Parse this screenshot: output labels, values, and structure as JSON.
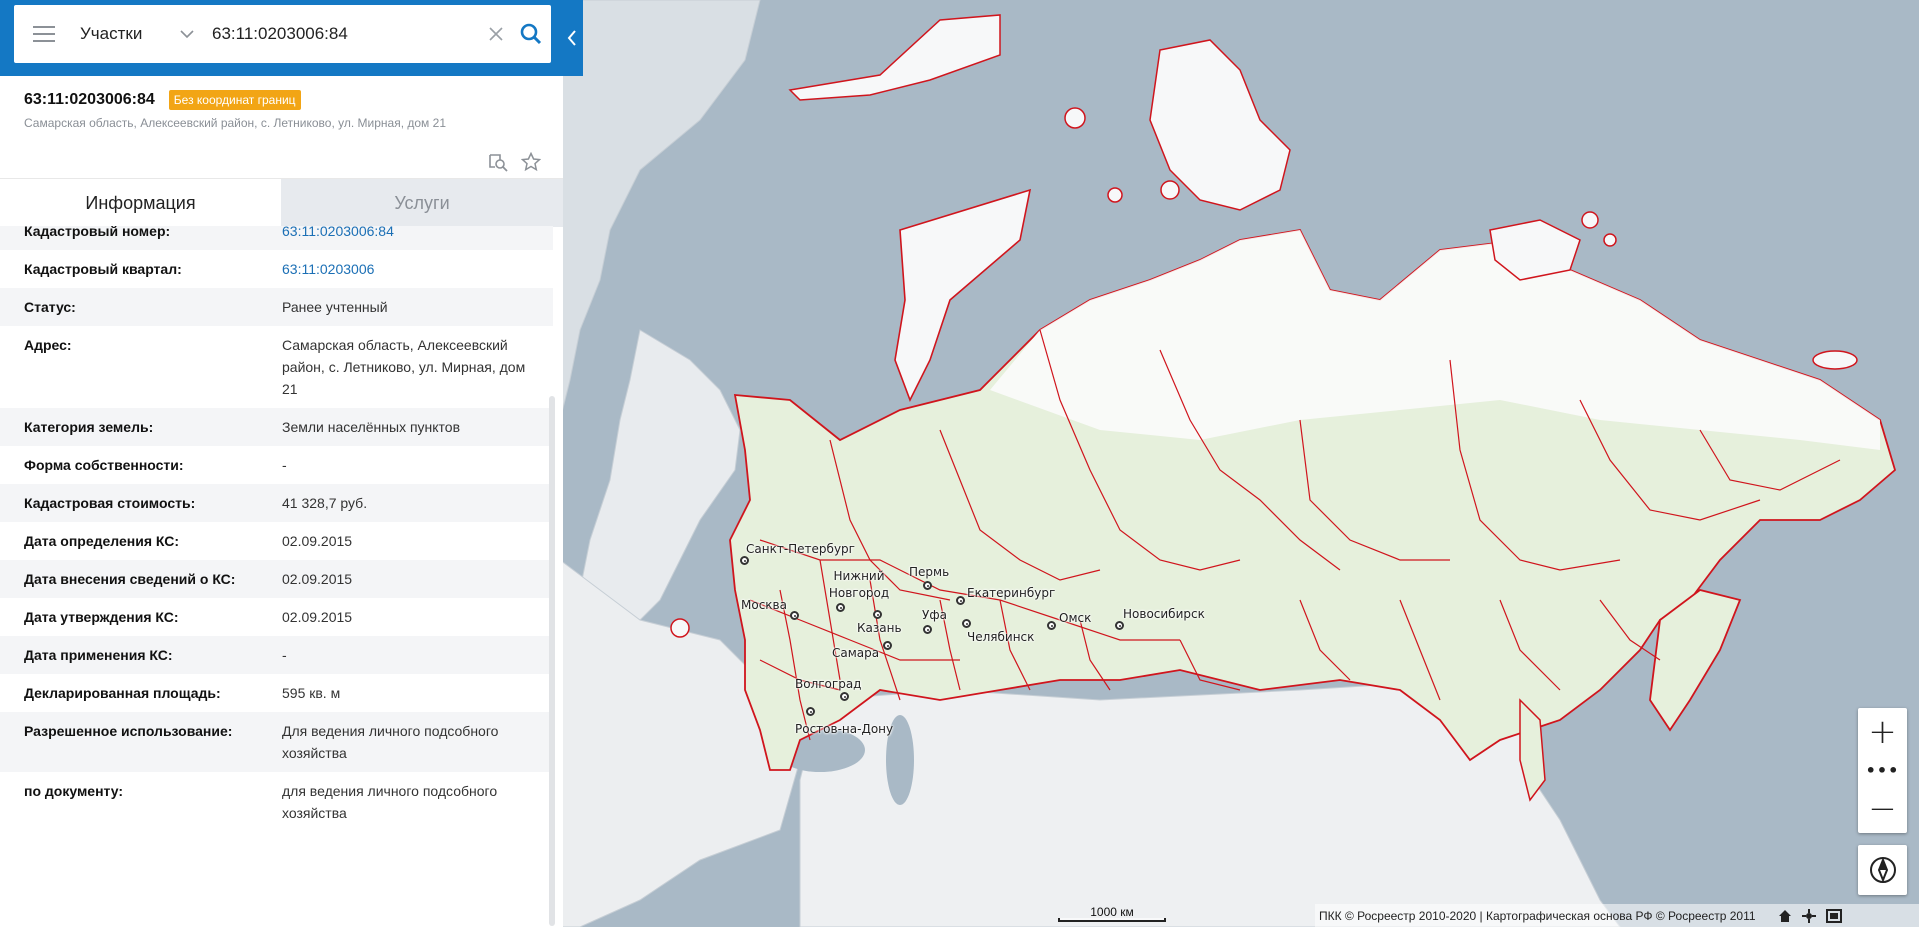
{
  "search": {
    "type_label": "Участки",
    "query": "63:11:0203006:84"
  },
  "object": {
    "cad_number": "63:11:0203006:84",
    "badge": "Без координат границ",
    "address": "Самарская область, Алексеевский район, с. Летниково, ул. Мирная, дом 21"
  },
  "tabs": [
    {
      "label": "Информация"
    },
    {
      "label": "Услуги"
    }
  ],
  "info": [
    {
      "key": "Кадастровый номер:",
      "value": "63:11:0203006:84"
    },
    {
      "key": "Кадастровый квартал:",
      "value": "63:11:0203006"
    },
    {
      "key": "Статус:",
      "value": "Ранее учтенный"
    },
    {
      "key": "Адрес:",
      "value": "Самарская область, Алексеевский район, с. Летниково, ул. Мирная, дом 21"
    },
    {
      "key": "Категория земель:",
      "value": "Земли населённых пунктов"
    },
    {
      "key": "Форма собственности:",
      "value": "-"
    },
    {
      "key": "Кадастровая стоимость:",
      "value": "41 328,7 руб."
    },
    {
      "key": "Дата определения КС:",
      "value": "02.09.2015"
    },
    {
      "key": "Дата внесения сведений о КС:",
      "value": "02.09.2015"
    },
    {
      "key": "Дата утверждения КС:",
      "value": "02.09.2015"
    },
    {
      "key": "Дата применения КС:",
      "value": "-"
    },
    {
      "key": "Декларированная площадь:",
      "value": "595 кв. м"
    },
    {
      "key": "Разрешенное использование:",
      "value": "Для ведения личного подсобного хозяйства"
    },
    {
      "key": "по документу:",
      "value": "для ведения личного подсобного хозяйства"
    }
  ],
  "map": {
    "cities": [
      {
        "name": "Санкт-Петербург"
      },
      {
        "name": "Нижний Новгород"
      },
      {
        "name": "Москва"
      },
      {
        "name": "Пермь"
      },
      {
        "name": "Екатеринбург"
      },
      {
        "name": "Уфа"
      },
      {
        "name": "Казань"
      },
      {
        "name": "Челябинск"
      },
      {
        "name": "Омск"
      },
      {
        "name": "Новосибирск"
      },
      {
        "name": "Самара"
      },
      {
        "name": "Волгоград"
      },
      {
        "name": "Ростов-на-Дону"
      }
    ],
    "scale_label": "1000 км",
    "attribution": "ПКК © Росреестр 2010-2020 | Картографическая основа РФ © Росреестр 2011",
    "zoom_in": "+",
    "zoom_more": "•••",
    "zoom_out": "−",
    "colors": {
      "sea": "#a9b9c6",
      "land": "#eef1f3",
      "russia_fill": "#e6f0dc",
      "border": "#d0151d",
      "header_blue": "#1478c4",
      "badge": "#f2a515"
    }
  }
}
